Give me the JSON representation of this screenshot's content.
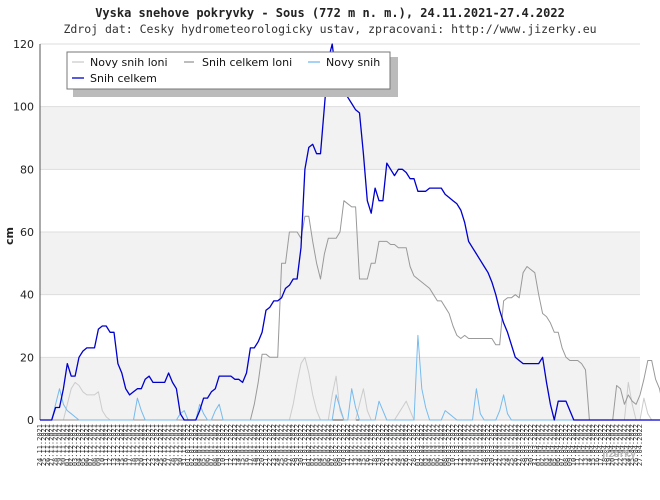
{
  "chart_data": {
    "type": "line",
    "title": "Vyska snehove pokryvky - Sous (772 m n. m.), 24.11.2021-27.4.2022",
    "subtitle": "Zdroj dat: Cesky hydrometeorologicky ustav, zpracovani: http://www.jizerky.eu",
    "ylabel": "cm",
    "ylim": [
      0,
      120
    ],
    "yticks": [
      0,
      20,
      40,
      60,
      80,
      100,
      120
    ],
    "grid": true,
    "legend_position": "top-left",
    "watermark": "jizerky",
    "x_start": "2021-11-24",
    "x_end": "2022-04-27",
    "series": [
      {
        "name": "Novy snih loni",
        "color": "#cccccc",
        "values": [
          0,
          0,
          0,
          0,
          0,
          0,
          0,
          5,
          10,
          12,
          11,
          9,
          8,
          8,
          8,
          9,
          3,
          1,
          0,
          0,
          0,
          0,
          0,
          0,
          0,
          0,
          0,
          0,
          0,
          0,
          0,
          0,
          0,
          0,
          0,
          0,
          0,
          0,
          0,
          0,
          0,
          0,
          0,
          0,
          0,
          0,
          0,
          0,
          0,
          0,
          0,
          0,
          0,
          0,
          0,
          0,
          0,
          0,
          0,
          0,
          0,
          0,
          0,
          0,
          0,
          5,
          12,
          18,
          20,
          15,
          8,
          3,
          0,
          0,
          0,
          8,
          14,
          3,
          0,
          0,
          0,
          0,
          5,
          10,
          3,
          0,
          0,
          0,
          0,
          0,
          0,
          0,
          2,
          4,
          6,
          3,
          0,
          0,
          0,
          0,
          0,
          0,
          0,
          0,
          0,
          0,
          0,
          0,
          0,
          0,
          0,
          0,
          0,
          0,
          0,
          0,
          0,
          0,
          0,
          0,
          0,
          0,
          0,
          0,
          0,
          0,
          0,
          0,
          0,
          0,
          0,
          0,
          0,
          0,
          0,
          0,
          0,
          0,
          0,
          0,
          0,
          0,
          0,
          0,
          0,
          0,
          0,
          0,
          0,
          0,
          0,
          12,
          5,
          0,
          0,
          7,
          2,
          0,
          0,
          0,
          0,
          0,
          0,
          0,
          0,
          0,
          0,
          0,
          0,
          0,
          0,
          0,
          0,
          0,
          0,
          0,
          0,
          0
        ]
      },
      {
        "name": "Snih celkem loni",
        "color": "#999999",
        "values": [
          0,
          0,
          0,
          0,
          0,
          0,
          0,
          0,
          0,
          0,
          0,
          0,
          0,
          0,
          0,
          0,
          0,
          0,
          0,
          0,
          0,
          0,
          0,
          0,
          0,
          0,
          0,
          0,
          0,
          0,
          0,
          0,
          0,
          0,
          0,
          0,
          0,
          0,
          0,
          0,
          0,
          0,
          0,
          0,
          0,
          0,
          0,
          0,
          0,
          0,
          0,
          0,
          0,
          0,
          0,
          5,
          12,
          21,
          21,
          20,
          20,
          20,
          50,
          50,
          60,
          60,
          60,
          58,
          65,
          65,
          57,
          50,
          45,
          53,
          58,
          58,
          58,
          60,
          70,
          69,
          68,
          68,
          45,
          45,
          45,
          50,
          50,
          57,
          57,
          57,
          56,
          56,
          55,
          55,
          55,
          49,
          46,
          45,
          44,
          43,
          42,
          40,
          38,
          38,
          36,
          34,
          30,
          27,
          26,
          27,
          26,
          26,
          26,
          26,
          26,
          26,
          26,
          24,
          24,
          38,
          39,
          39,
          40,
          39,
          47,
          49,
          48,
          47,
          40,
          34,
          33,
          31,
          28,
          28,
          23,
          20,
          19,
          19,
          19,
          18,
          16,
          0,
          0,
          0,
          0,
          0,
          0,
          0,
          11,
          10,
          5,
          8,
          6,
          5,
          8,
          13,
          19,
          19,
          13,
          10,
          4,
          7,
          6,
          5,
          5,
          9,
          12,
          8
        ]
      },
      {
        "name": "Novy snih",
        "color": "#77bbee",
        "values": [
          0,
          0,
          0,
          0,
          5,
          10,
          5,
          3,
          2,
          1,
          0,
          0,
          0,
          0,
          0,
          0,
          0,
          0,
          0,
          0,
          0,
          0,
          0,
          0,
          0,
          7,
          3,
          0,
          0,
          0,
          0,
          0,
          0,
          0,
          0,
          0,
          2,
          3,
          0,
          0,
          0,
          5,
          2,
          0,
          0,
          3,
          5,
          0,
          0,
          0,
          0,
          0,
          0,
          0,
          0,
          0,
          0,
          0,
          0,
          0,
          0,
          0,
          0,
          0,
          0,
          0,
          0,
          0,
          0,
          0,
          0,
          0,
          0,
          0,
          0,
          0,
          8,
          4,
          0,
          0,
          10,
          4,
          0,
          0,
          0,
          0,
          0,
          6,
          3,
          0,
          0,
          0,
          0,
          0,
          0,
          0,
          0,
          27,
          10,
          4,
          0,
          0,
          0,
          0,
          3,
          2,
          1,
          0,
          0,
          0,
          0,
          0,
          10,
          2,
          0,
          0,
          0,
          0,
          3,
          8,
          2,
          0,
          0,
          0,
          0,
          0,
          0,
          0,
          0,
          0,
          0,
          0,
          0,
          0,
          0,
          0,
          0,
          0,
          0,
          0,
          0,
          0,
          0,
          0,
          0,
          0,
          0,
          0,
          0,
          0,
          0,
          0,
          0,
          0,
          0,
          0,
          0,
          0,
          0,
          0,
          0,
          0,
          0,
          0,
          0,
          5,
          2,
          0,
          0,
          0,
          0,
          0,
          0,
          0,
          0,
          0,
          0,
          0,
          0,
          0
        ]
      },
      {
        "name": "Snih celkem",
        "color": "#0000cc",
        "values": [
          0,
          0,
          0,
          0,
          4,
          4,
          10,
          18,
          14,
          14,
          20,
          22,
          23,
          23,
          23,
          29,
          30,
          30,
          28,
          28,
          18,
          15,
          10,
          8,
          9,
          10,
          10,
          13,
          14,
          12,
          12,
          12,
          12,
          15,
          12,
          10,
          2,
          0,
          0,
          0,
          0,
          3,
          7,
          7,
          9,
          10,
          14,
          14,
          14,
          14,
          13,
          13,
          12,
          15,
          23,
          23,
          25,
          28,
          35,
          36,
          38,
          38,
          39,
          42,
          43,
          45,
          45,
          55,
          80,
          87,
          88,
          85,
          85,
          100,
          115,
          120,
          110,
          108,
          105,
          103,
          101,
          99,
          98,
          85,
          70,
          66,
          74,
          70,
          70,
          82,
          80,
          78,
          80,
          80,
          79,
          77,
          77,
          73,
          73,
          73,
          74,
          74,
          74,
          74,
          72,
          71,
          70,
          69,
          67,
          63,
          57,
          55,
          53,
          51,
          49,
          47,
          44,
          40,
          35,
          31,
          28,
          24,
          20,
          19,
          18,
          18,
          18,
          18,
          18,
          20,
          12,
          5,
          0,
          6,
          6,
          6,
          3,
          0,
          0,
          0,
          0,
          0,
          0,
          0,
          0,
          0,
          0,
          0,
          0,
          0,
          0,
          0,
          0,
          0,
          0,
          0,
          0,
          0,
          0,
          0,
          0,
          0,
          0,
          0,
          0,
          0,
          0,
          0,
          0,
          0,
          0,
          0,
          0
        ]
      }
    ]
  }
}
